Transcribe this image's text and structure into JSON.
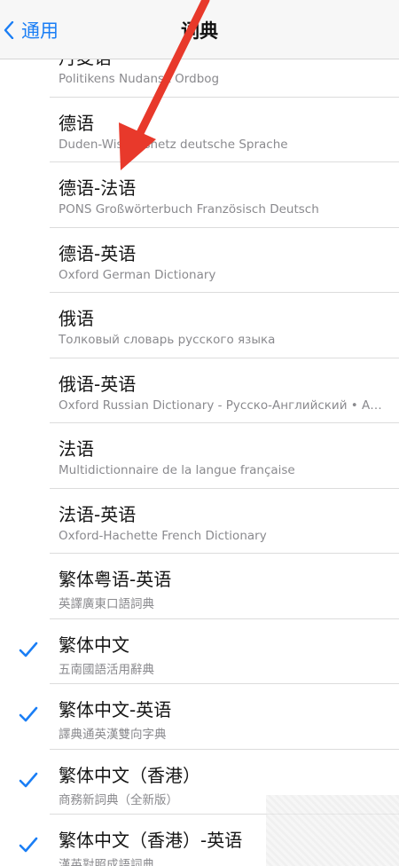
{
  "nav": {
    "back_label": "通用",
    "title": "词典"
  },
  "colors": {
    "accent": "#1a7ef5",
    "annotation": "#e8392b"
  },
  "annotation": {
    "type": "red-arrow",
    "points_to": "德语-法语"
  },
  "dictionaries": [
    {
      "title": "丹麦语",
      "subtitle": "Politikens Nudansk Ordbog",
      "checked": false
    },
    {
      "title": "德语",
      "subtitle": "Duden-Wissensnetz deutsche Sprache",
      "checked": false
    },
    {
      "title": "德语-法语",
      "subtitle": "PONS Großwörterbuch Französisch Deutsch",
      "checked": false
    },
    {
      "title": "德语-英语",
      "subtitle": "Oxford German Dictionary",
      "checked": false
    },
    {
      "title": "俄语",
      "subtitle": "Толковый словарь русского языка",
      "checked": false
    },
    {
      "title": "俄语-英语",
      "subtitle": "Oxford Russian Dictionary - Русско-Английский • Англо-Русский",
      "checked": false
    },
    {
      "title": "法语",
      "subtitle": "Multidictionnaire de la langue française",
      "checked": false
    },
    {
      "title": "法语-英语",
      "subtitle": "Oxford-Hachette French Dictionary",
      "checked": false
    },
    {
      "title": "繁体粤语-英语",
      "subtitle": "英譯廣東口語詞典",
      "checked": false
    },
    {
      "title": "繁体中文",
      "subtitle": "五南國語活用辭典",
      "checked": true
    },
    {
      "title": "繁体中文-英语",
      "subtitle": "譯典通英漢雙向字典",
      "checked": true
    },
    {
      "title": "繁体中文（香港）",
      "subtitle": "商務新詞典（全新版）",
      "checked": true
    },
    {
      "title": "繁体中文（香港）-英语",
      "subtitle": "漢英對照成語詞典",
      "checked": true
    }
  ]
}
